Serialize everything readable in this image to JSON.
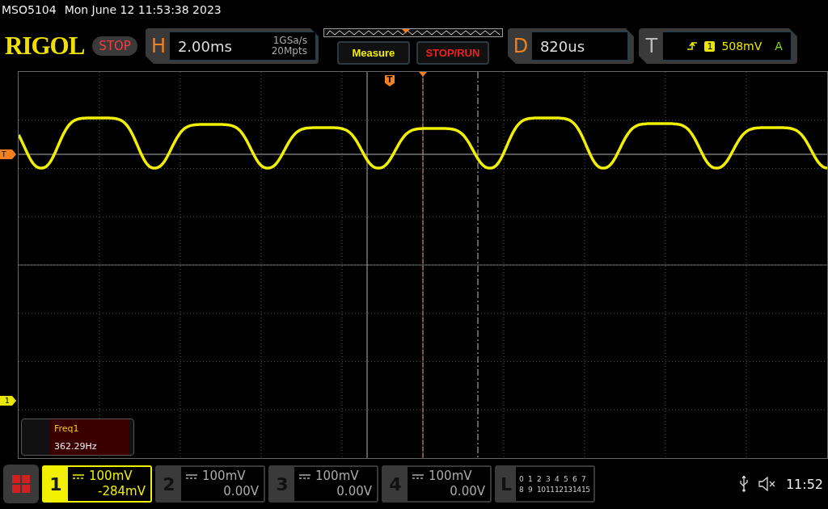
{
  "model": "MSO5104",
  "datetime": "Mon June 12 11:53:38 2023",
  "logo": "RIGOL",
  "run_state": "STOP",
  "horizontal": {
    "label": "H",
    "timebase": "2.00ms",
    "sample_rate": "1GSa/s",
    "memory_depth": "20Mpts"
  },
  "buttons": [
    {
      "label": "Measure",
      "kind": "measure"
    },
    {
      "label": "STOP/RUN",
      "kind": "stoprun"
    }
  ],
  "delay": {
    "label": "D",
    "value": "820us"
  },
  "trigger": {
    "label": "T",
    "source": "1",
    "level": "508mV",
    "mode": "A"
  },
  "markers": {
    "trigger_position": "T",
    "trigger_level": "T",
    "channel_1": "1"
  },
  "measurement": {
    "name": "Freq1",
    "value": "362.29Hz"
  },
  "channels": [
    {
      "number": "1",
      "scale": "100mV",
      "offset": "-284mV",
      "selected": true
    },
    {
      "number": "2",
      "scale": "100mV",
      "offset": "0.00V",
      "selected": false
    },
    {
      "number": "3",
      "scale": "100mV",
      "offset": "0.00V",
      "selected": false
    },
    {
      "number": "4",
      "scale": "100mV",
      "offset": "0.00V",
      "selected": false
    }
  ],
  "logic": {
    "label": "L",
    "rows": [
      [
        "0",
        "1",
        "2",
        "3",
        "4",
        "5",
        "6",
        "7"
      ],
      [
        "8",
        "9",
        "10",
        "11",
        "12",
        "13",
        "14",
        "15"
      ]
    ]
  },
  "status": {
    "time": "11:52"
  }
}
